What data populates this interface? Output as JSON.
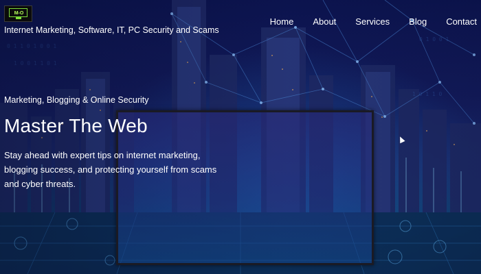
{
  "header": {
    "logo_text": "M-O",
    "tagline": "Internet Marketing, Software, IT, PC Security and Scams"
  },
  "nav": {
    "items": [
      {
        "label": "Home"
      },
      {
        "label": "About"
      },
      {
        "label": "Services"
      },
      {
        "label": "Blog"
      },
      {
        "label": "Contact"
      }
    ]
  },
  "hero": {
    "eyebrow": "Marketing, Blogging & Online Security",
    "headline": "Master The Web",
    "lead": "Stay ahead with expert tips on internet marketing, blogging success, and protecting yourself from scams and cyber threats."
  },
  "colors": {
    "text": "#ffffff",
    "background": "#131b5c",
    "logo_accent": "#7ddc3a"
  }
}
